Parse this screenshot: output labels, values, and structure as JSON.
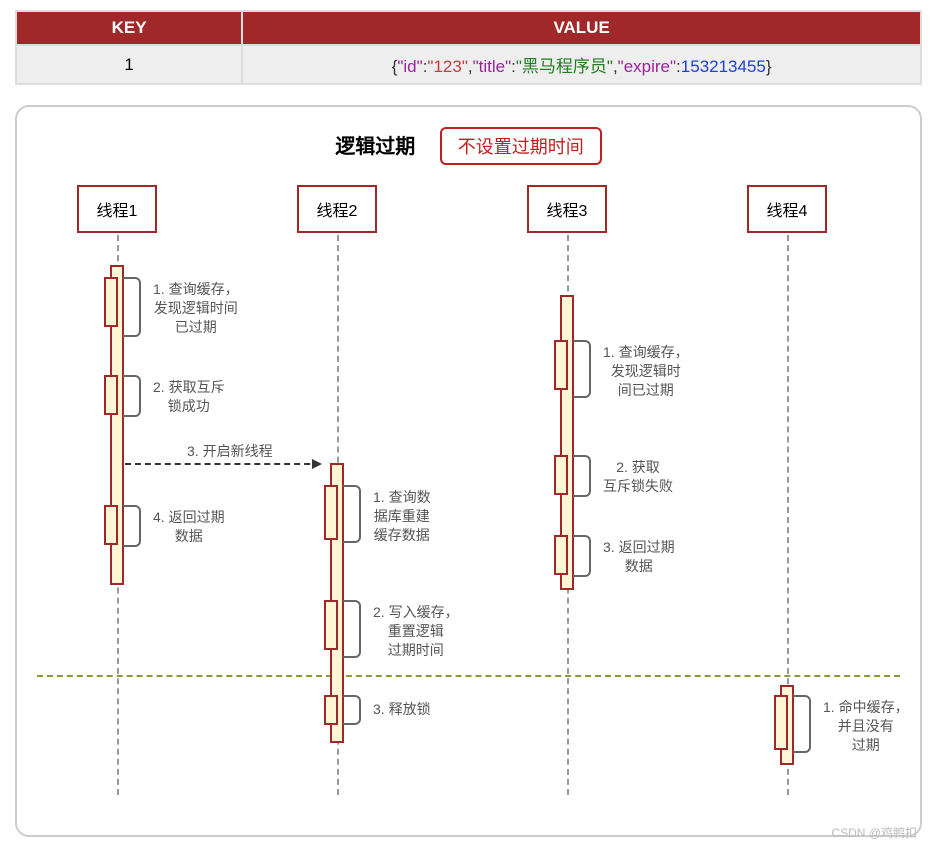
{
  "table": {
    "headers": {
      "key": "KEY",
      "value": "VALUE"
    },
    "row": {
      "key": "1",
      "json_parts": {
        "open": "{",
        "k_id": "\"id\"",
        "c1": ":",
        "v_id": "\"123\"",
        "s1": ",",
        "k_title": "\"title\"",
        "c2": ":",
        "v_title": "\"黑马程序员\"",
        "s2": ",",
        "k_exp": "\"expire\"",
        "c3": ":",
        "v_exp": "153213455",
        "close": "}"
      }
    }
  },
  "diagram": {
    "title": "逻辑过期",
    "badge": "不设置过期时间",
    "lanes": {
      "t1": "线程1",
      "t2": "线程2",
      "t3": "线程3",
      "t4": "线程4"
    },
    "steps": {
      "t1_1": "1. 查询缓存，\n发现逻辑时间\n已过期",
      "t1_2": "2. 获取互斥\n锁成功",
      "t1_3": "3. 开启新线程",
      "t1_4": "4. 返回过期\n数据",
      "t2_1": "1. 查询数\n据库重建\n缓存数据",
      "t2_2": "2. 写入缓存，\n重置逻辑\n过期时间",
      "t2_3": "3. 释放锁",
      "t3_1": "1. 查询缓存，\n发现逻辑时\n间已过期",
      "t3_2": "2. 获取\n互斥锁失败",
      "t3_3": "3. 返回过期\n数据",
      "t4_1": "1. 命中缓存，\n并且没有\n过期"
    }
  },
  "watermark": "CSDN @鸡鸭扣"
}
